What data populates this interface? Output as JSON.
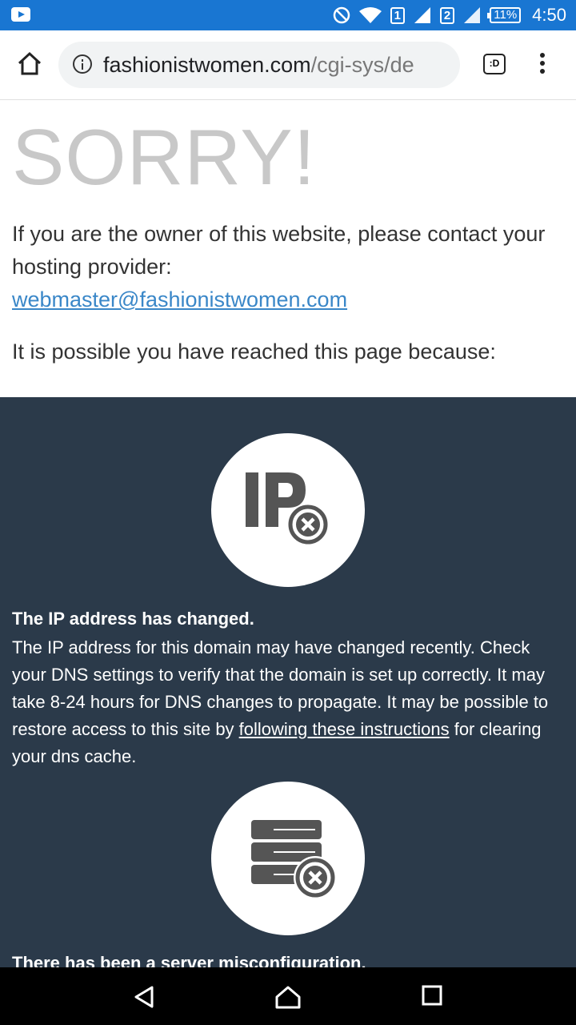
{
  "status_bar": {
    "sim1": "1",
    "sim2": "2",
    "battery": "11%",
    "time": "4:50",
    "icons": [
      "youtube-notification-icon",
      "do-not-disturb-icon",
      "wifi-icon",
      "signal-icon",
      "battery-icon"
    ]
  },
  "browser": {
    "url_domain": "fashionistwomen.com",
    "url_path": "/cgi-sys/de",
    "tab_count_label": ":D"
  },
  "page": {
    "heading": "SORRY!",
    "intro": "If you are the owner of this website, please contact your hosting provider:",
    "email": "webmaster@fashionistwomen.com",
    "reason": "It is possible you have reached this page because:",
    "ip_title": "The IP address has changed.",
    "ip_body_before_link": "The IP address for this domain may have changed recently. Check your DNS settings to verify that the domain is set up correctly. It may take 8-24 hours for DNS changes to propagate. It may be possible to restore access to this site by ",
    "ip_link": "following these instructions",
    "ip_body_after_link": " for clearing your dns cache.",
    "misconfig_title": "There has been a server misconfiguration."
  },
  "colors": {
    "status_bar": "#1976d2",
    "dark_panel": "#2b3a4a",
    "link": "#3a87c8",
    "heading": "#c8c8c8"
  }
}
